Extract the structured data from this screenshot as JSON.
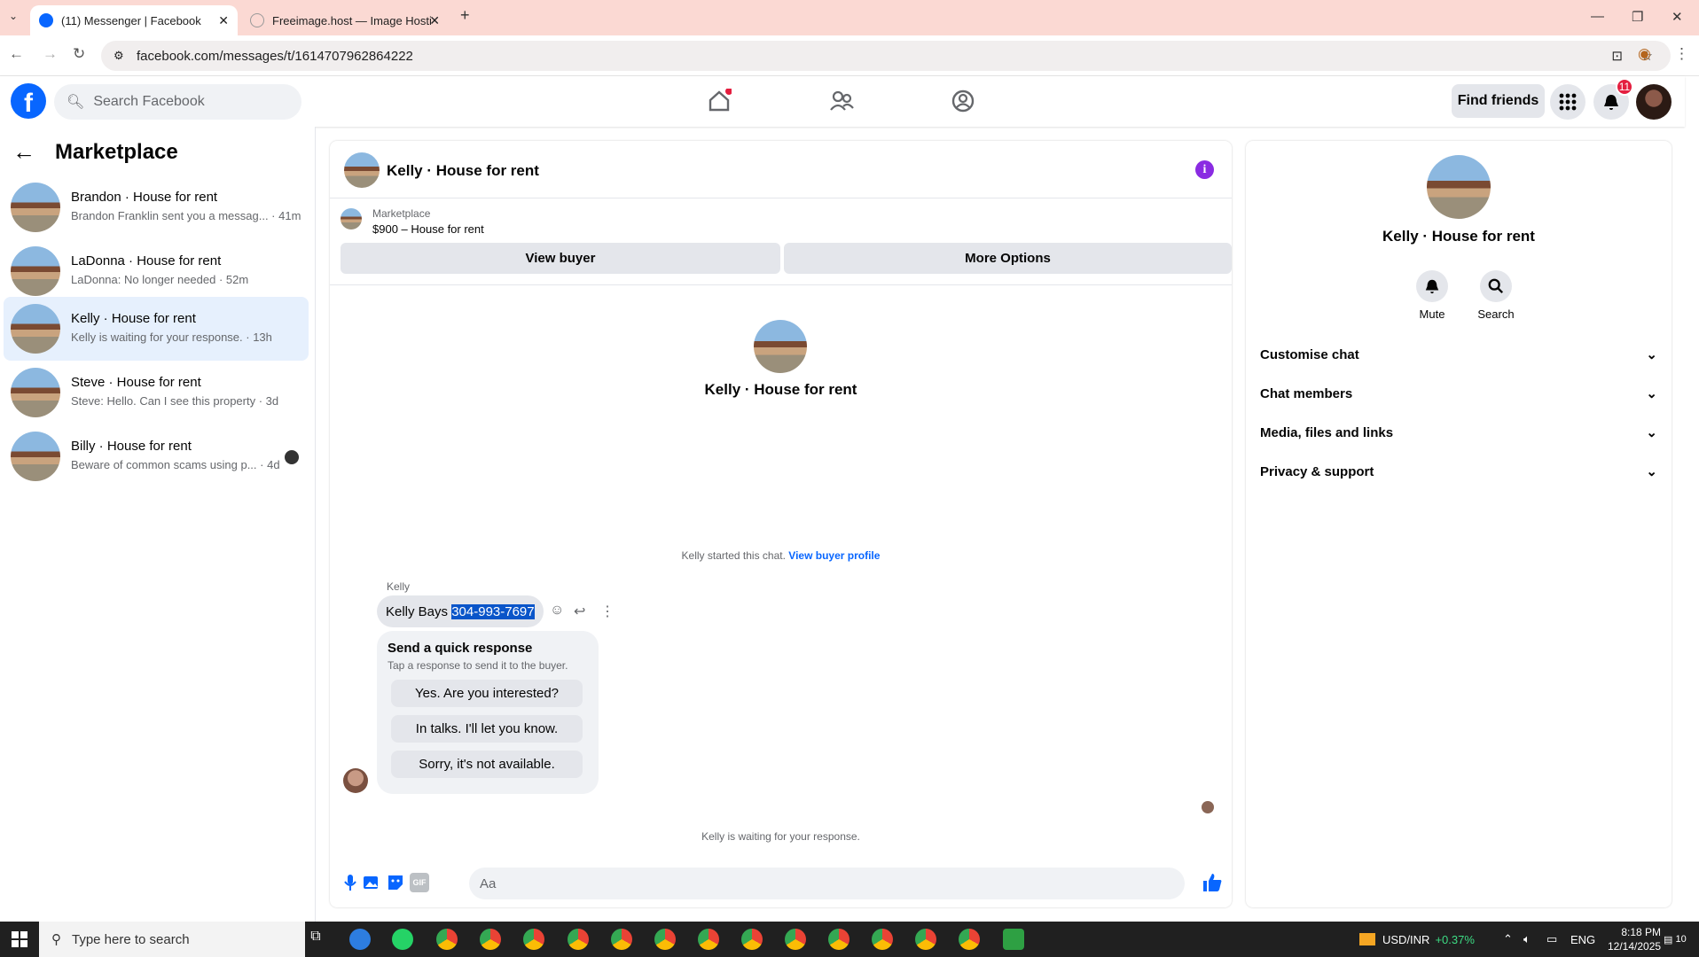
{
  "browser": {
    "tabs": [
      {
        "title": "(11) Messenger | Facebook"
      },
      {
        "title": "Freeimage.host — Image Hosti"
      }
    ],
    "new_tab": "+",
    "url": "facebook.com/messages/t/1614707962864222"
  },
  "fb": {
    "search_placeholder": "Search Facebook",
    "find_friends": "Find friends",
    "notif_count": "11"
  },
  "sidebar": {
    "title": "Marketplace",
    "conversations": [
      {
        "name": "Brandon · House for rent",
        "preview": "Brandon Franklin sent you a messag... · 41m"
      },
      {
        "name": "LaDonna · House for rent",
        "preview": "LaDonna: No longer needed · 52m"
      },
      {
        "name": "Kelly · House for rent",
        "preview": "Kelly is waiting for your response. · 13h"
      },
      {
        "name": "Steve · House for rent",
        "preview": "Steve: Hello. Can I see this property · 3d"
      },
      {
        "name": "Billy · House for rent",
        "preview": "Beware of common scams using p... · 4d"
      }
    ]
  },
  "chat": {
    "title": "Kelly · House for rent",
    "marketplace_label": "Marketplace",
    "listing": "$900 – House for rent",
    "view_buyer": "View buyer",
    "more_options": "More Options",
    "intro_name": "Kelly · House for rent",
    "started_text": "Kelly started this chat.",
    "view_buyer_profile": "View buyer profile",
    "sender": "Kelly",
    "message_prefix": "Kelly Bays ",
    "message_highlight": "304-993-7697",
    "quick_title": "Send a quick response",
    "quick_sub": "Tap a response to send it to the buyer.",
    "quick_replies": [
      "Yes. Are you interested?",
      "In talks. I'll let you know.",
      "Sorry, it's not available."
    ],
    "waiting": "Kelly is waiting for your response.",
    "input_placeholder": "Aa",
    "gif": "GIF"
  },
  "details": {
    "name": "Kelly · House for rent",
    "mute": "Mute",
    "search": "Search",
    "sections": [
      "Customise chat",
      "Chat members",
      "Media, files and links",
      "Privacy & support"
    ]
  },
  "taskbar": {
    "search_placeholder": "Type here to search",
    "currency": "USD/INR",
    "change": "+0.37%",
    "lang": "ENG",
    "time": "8:18 PM",
    "date": "12/14/2025",
    "notif": "10"
  },
  "colors": {
    "brand": "#0866ff",
    "accent_purple": "#8a2be2",
    "tabbar": "#fbd9d3"
  }
}
